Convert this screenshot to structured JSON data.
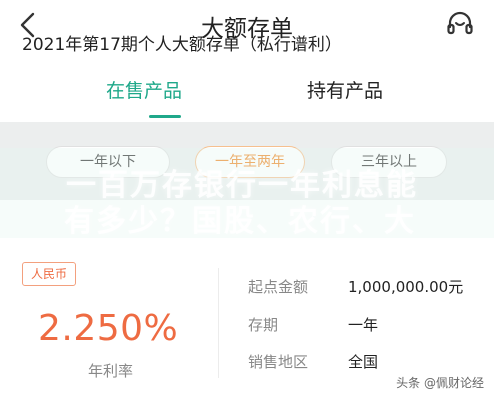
{
  "header": {
    "title": "大额存单",
    "back_icon": "chevron-left-icon",
    "support_icon": "headset-icon"
  },
  "tabs": [
    {
      "label": "在售产品",
      "active": true
    },
    {
      "label": "持有产品",
      "active": false
    }
  ],
  "filters": [
    {
      "label": "一年以下",
      "selected": false
    },
    {
      "label": "一年至两年",
      "selected": true
    },
    {
      "label": "三年以上",
      "selected": false
    }
  ],
  "overlay": {
    "line1": "一百万存银行一年利息能",
    "line2": "有多少？国股、农行、大"
  },
  "product": {
    "title": "2021年第17期个人大额存单（私行谱利）",
    "currency": "人民币",
    "rate": "2.250%",
    "rate_label": "年利率",
    "details": [
      {
        "label": "起点金额",
        "value": "1,000,000.00元"
      },
      {
        "label": "存期",
        "value": "一年"
      },
      {
        "label": "销售地区",
        "value": "全国"
      }
    ]
  },
  "watermark": "头条 @佩财论经",
  "colors": {
    "accent_green": "#1fa88a",
    "rate_orange": "#ee6b42",
    "selected_pill_orange": "#f08a2a"
  }
}
